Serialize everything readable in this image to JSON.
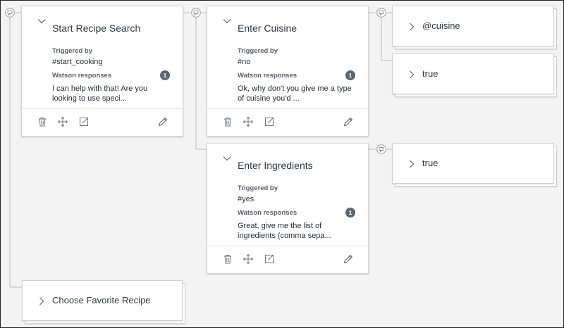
{
  "nodes": {
    "start": {
      "title": "Start Recipe Search",
      "triggered_label": "Triggered by",
      "trigger": "#start_cooking",
      "responses_label": "Watson responses",
      "response_count": "1",
      "response": "I can help with that! Are you looking to use speci..."
    },
    "cuisine": {
      "title": "Enter Cuisine",
      "triggered_label": "Triggered by",
      "trigger": "#no",
      "responses_label": "Watson responses",
      "response_count": "1",
      "response": "Ok, why don't you give me a type of cuisine you'd ..."
    },
    "ingredients": {
      "title": "Enter Ingredients",
      "triggered_label": "Triggered by",
      "trigger": "#yes",
      "responses_label": "Watson responses",
      "response_count": "1",
      "response": "Great, give me the list of ingredients (comma sepa..."
    },
    "at_cuisine": {
      "label": "@cuisine"
    },
    "cuisine_true": {
      "label": "true"
    },
    "ingredients_true": {
      "label": "true"
    },
    "favorite": {
      "label": "Choose Favorite Recipe"
    }
  },
  "icons": {
    "node": "speech-bubble-icon",
    "collapse": "chevron-down-icon",
    "expand": "chevron-right-icon",
    "delete": "trash-icon",
    "move": "move-icon",
    "jump": "jump-to-icon",
    "edit": "pencil-icon"
  },
  "colors": {
    "background": "#f3f3f3",
    "card": "#ffffff",
    "badge": "#5a6872",
    "connector": "#b8b8b8"
  }
}
